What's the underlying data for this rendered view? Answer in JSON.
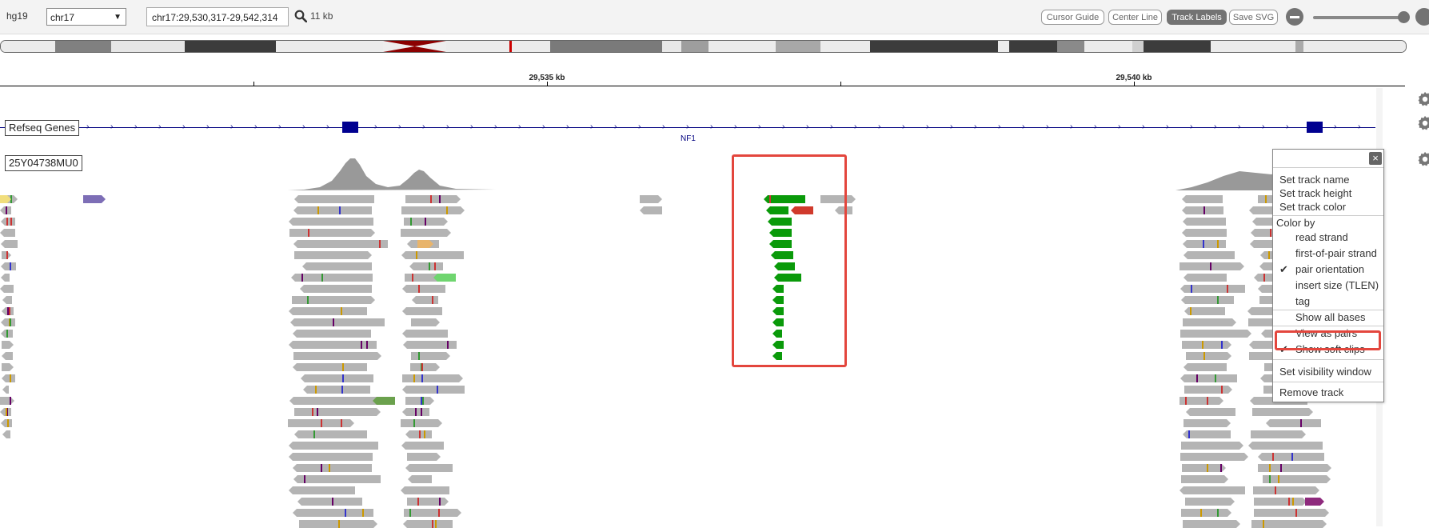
{
  "navbar": {
    "genome": "hg19",
    "chromosome": "chr17",
    "locus": "chr17:29,530,317-29,542,314",
    "window_size": "11 kb",
    "buttons": [
      "Cursor Guide",
      "Center Line",
      "Track Labels",
      "Save SVG"
    ],
    "active_button": "Track Labels"
  },
  "ruler": {
    "ticks": [
      "29,535 kb",
      "29,540 kb"
    ]
  },
  "tracks": {
    "refseq_label": "Refseq Genes",
    "gene_name": "NF1",
    "alignment_label": "25Y04738MU0"
  },
  "track_menu": {
    "items": [
      "Set track name",
      "Set track height",
      "Set track color",
      "Color by",
      "read strand",
      "first-of-pair strand",
      "pair orientation",
      "insert size (TLEN)",
      "tag",
      "Show all bases",
      "View as pairs",
      "Show soft clips",
      "Set visibility window",
      "Remove track"
    ],
    "checked": [
      "pair orientation",
      "Show soft clips"
    ],
    "close": "×"
  },
  "colors": {
    "soft_clip_read": "#0a9a0a",
    "highlight": "#e3463d",
    "gene": "#000080",
    "read": "#b4b4b4"
  }
}
